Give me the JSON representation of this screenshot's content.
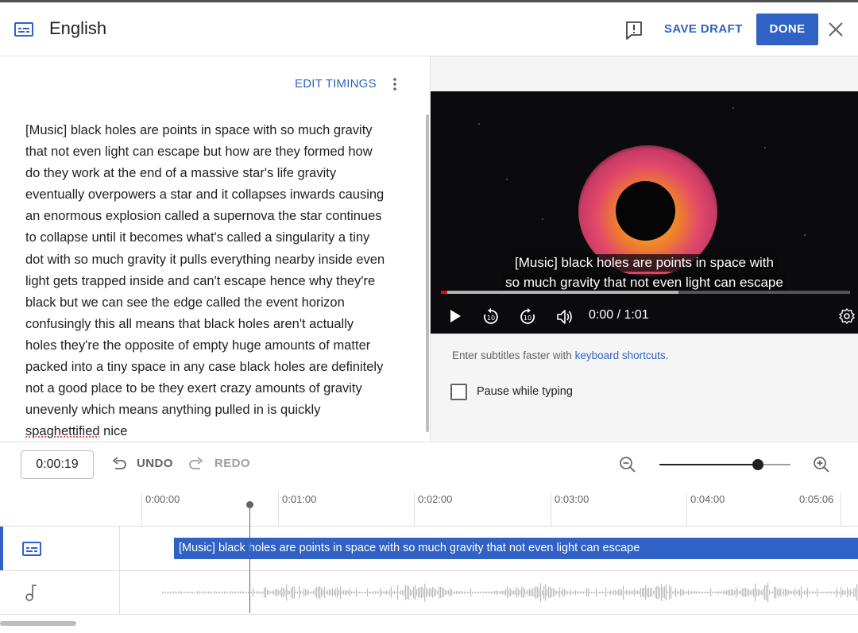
{
  "header": {
    "language": "English",
    "save_draft_label": "SAVE DRAFT",
    "done_label": "DONE"
  },
  "editor": {
    "edit_timings_label": "EDIT TIMINGS",
    "transcript_lines": [
      "[Music] black holes are points in space with so much gravity",
      "that not even light can escape but how are they formed how",
      "do they work at the end of a massive star's life gravity",
      "eventually overpowers a star and it collapses inwards causing",
      "an enormous explosion called a supernova the star continues",
      "to collapse until it becomes what's called a singularity a tiny",
      "dot with so much gravity it pulls everything nearby inside even",
      "light gets trapped inside and can't escape hence why they're",
      "black but we can see the edge called the event horizon",
      "confusingly this all means that black holes aren't actually",
      "holes they're the opposite of empty huge amounts of matter",
      "packed into a tiny space in any case black holes are definitely",
      "not a good place to be they exert crazy amounts of gravity",
      "unevenly which means anything pulled in is quickly"
    ],
    "last_line_misspelled": "spaghettified",
    "last_line_rest": " nice"
  },
  "player": {
    "caption_line_1": "[Music] black holes are points in space with",
    "caption_line_2": "so much gravity that not even light can escape",
    "time_display": "0:00 / 1:01",
    "progress_played_fraction": 0.015,
    "progress_buffered_fraction": 0.58
  },
  "side": {
    "tip_text": "Enter subtitles faster with ",
    "tip_link": "keyboard shortcuts",
    "tip_end": ".",
    "pause_label": "Pause while typing",
    "pause_checked": false
  },
  "toolbar": {
    "current_time": "0:00:19",
    "undo_label": "UNDO",
    "redo_label": "REDO",
    "zoom_fraction": 0.75
  },
  "timeline": {
    "ticks": [
      "0:00:00",
      "0:01:00",
      "0:02:00",
      "0:03:00",
      "0:04:00",
      "0:05:06"
    ],
    "subtitle_block_text": "[Music] black holes are points in space with  so much gravity that not even light can escape"
  },
  "colors": {
    "accent": "#2f62c4",
    "progress_red": "#ff0000"
  },
  "icons": [
    "subtitles-icon",
    "feedback-icon",
    "close-icon",
    "more-vert-icon",
    "play-icon",
    "replay-10-icon",
    "forward-10-icon",
    "volume-icon",
    "settings-icon",
    "undo-icon",
    "redo-icon",
    "zoom-out-icon",
    "zoom-in-icon",
    "music-note-icon"
  ]
}
